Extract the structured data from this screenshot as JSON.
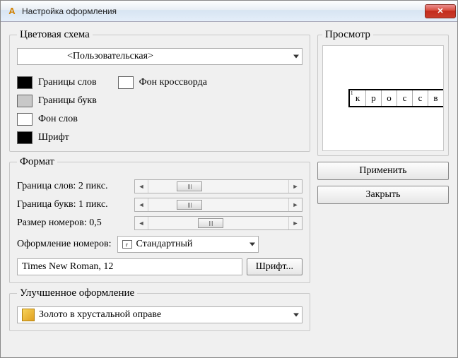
{
  "window": {
    "title": "Настройка оформления"
  },
  "color_scheme": {
    "legend": "Цветовая схема",
    "dropdown_value": "<Пользовательская>",
    "items": {
      "word_borders": "Границы слов",
      "crossword_bg": "Фон кроссворда",
      "letter_borders": "Границы букв",
      "word_bg": "Фон слов",
      "font": "Шрифт"
    }
  },
  "format": {
    "legend": "Формат",
    "word_border_label": "Граница слов: 2 пикс.",
    "letter_border_label": "Граница букв: 1 пикс.",
    "number_size_label": "Размер номеров: 0,5",
    "number_style_label": "Оформление номеров:",
    "number_style_value": "Стандартный",
    "font_display": "Times New Roman, 12",
    "font_button": "Шрифт..."
  },
  "enhanced": {
    "legend": "Улучшенное оформление",
    "value": "Золото в хрустальной оправе"
  },
  "preview": {
    "legend": "Просмотр",
    "cells": [
      "к",
      "р",
      "о",
      "с",
      "с",
      "в"
    ]
  },
  "buttons": {
    "apply": "Применить",
    "close": "Закрыть"
  }
}
